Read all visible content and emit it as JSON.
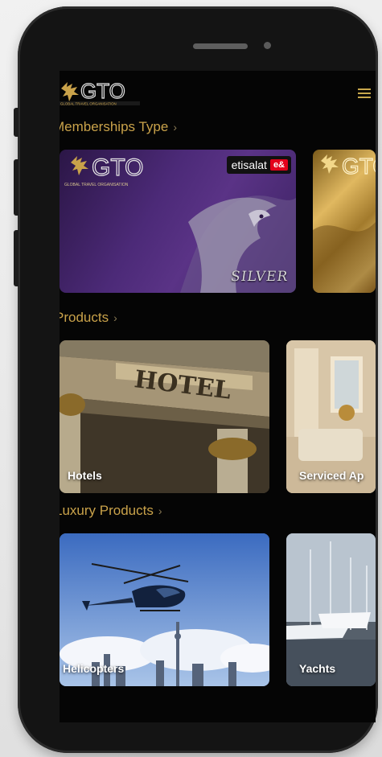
{
  "brand": {
    "logo_text": "GTO",
    "logo_subtext": "GLOBAL TRAVEL ORGANISATION"
  },
  "sections": {
    "memberships": {
      "title": "Memberships Type",
      "chevron": "›"
    },
    "products": {
      "title": "Products",
      "chevron": "›"
    },
    "luxury": {
      "title": "Luxury Products",
      "chevron": "›"
    }
  },
  "membership_cards": [
    {
      "tier": "SILVER",
      "partner": "etisalat",
      "partner_badge": "e&"
    },
    {
      "tier": ""
    }
  ],
  "products": [
    {
      "label": "Hotels",
      "sign_text": "HOTEL"
    },
    {
      "label": "Serviced Ap"
    }
  ],
  "luxury_products": [
    {
      "label": "Helicopters"
    },
    {
      "label": "Yachts"
    }
  ],
  "colors": {
    "accent_gold": "#c9a24a",
    "screen_bg": "#050505",
    "silver_card": "#4c2a78",
    "etisalat_red": "#e3001b"
  },
  "icons": [
    "menu-icon",
    "chevron-right-icon",
    "gto-griffin-logo"
  ]
}
